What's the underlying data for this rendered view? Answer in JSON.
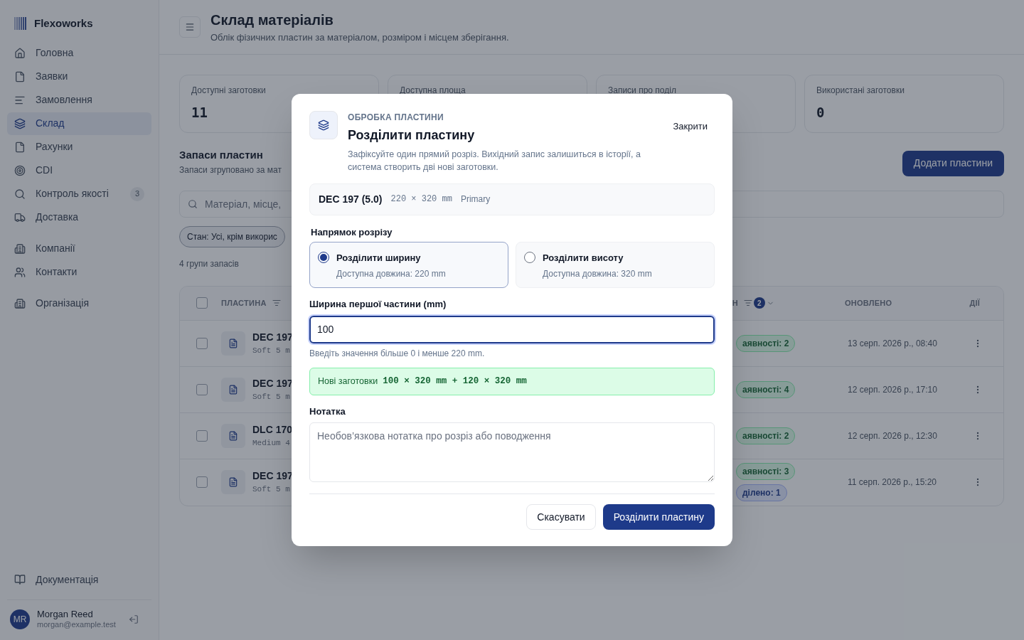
{
  "sidebar": {
    "brand": "Flexoworks",
    "groups": [
      [
        {
          "label": "Головна",
          "selected": false
        },
        {
          "label": "Заявки",
          "selected": false
        },
        {
          "label": "Замовлення",
          "selected": false
        },
        {
          "label": "Склад",
          "selected": true
        },
        {
          "label": "Рахунки",
          "selected": false
        },
        {
          "label": "CDI",
          "selected": false
        },
        {
          "label": "Контроль якості",
          "selected": false,
          "badge": "3"
        },
        {
          "label": "Доставка",
          "selected": false
        }
      ],
      [
        {
          "label": "Компанії",
          "selected": false
        },
        {
          "label": "Контакти",
          "selected": false
        }
      ],
      [
        {
          "label": "Організація",
          "selected": false
        }
      ]
    ],
    "footer_link": {
      "label": "Документація"
    },
    "user": {
      "initials": "MR",
      "name": "Morgan Reed",
      "email": "morgan@example.test"
    }
  },
  "header": {
    "title": "Склад матеріалів",
    "subtitle": "Облік фізичних пластин за матеріалом, розміром і місцем зберігання."
  },
  "stats": [
    {
      "label": "Доступні заготовки",
      "value": "11"
    },
    {
      "label": "Доступна площа"
    },
    {
      "label": "Записи про поділ"
    },
    {
      "label": "Використані заготовки",
      "value": "0"
    }
  ],
  "section": {
    "title": "Запаси пластин",
    "subtitle": "Запаси згруповано за мат",
    "add_button": "Додати пластини"
  },
  "search": {
    "placeholder": "Матеріал, місце,"
  },
  "filter_chip": "Стан: Усі, крім викорис",
  "count": "4 групи запасів",
  "table": {
    "all_selected": false,
    "columns": [
      {
        "label": "ПЛАСТИНА"
      },
      {
        "label": "Н",
        "filter_count": "2"
      },
      {
        "label": "ОНОВЛЕНО"
      },
      {
        "label": "ДІЇ"
      }
    ],
    "rows": [
      {
        "name": "DEC 197",
        "sub": "Soft 5 m",
        "badges": [
          {
            "text": "аявності: 2",
            "kind": "green"
          }
        ],
        "updated": "13 серп. 2026 р., 08:40",
        "selected": false
      },
      {
        "name": "DEC 197",
        "sub": "Soft 5 m",
        "badges": [
          {
            "text": "аявності: 4",
            "kind": "green"
          }
        ],
        "updated": "12 серп. 2026 р., 17:10",
        "selected": false
      },
      {
        "name": "DLC 170",
        "sub": "Medium 4",
        "badges": [
          {
            "text": "аявності: 2",
            "kind": "green"
          }
        ],
        "updated": "12 серп. 2026 р., 12:30",
        "selected": false
      },
      {
        "name": "DEC 197",
        "sub": "Soft 5 m",
        "badges": [
          {
            "text": "аявності: 3",
            "kind": "green"
          },
          {
            "text": "ділено: 1",
            "kind": "blue"
          }
        ],
        "updated": "11 серп. 2026 р., 15:20",
        "selected": false
      }
    ]
  },
  "dialog": {
    "eyebrow": "ОБРОБКА ПЛАСТИНИ",
    "title": "Розділити пластину",
    "close": "Закрити",
    "description": "Зафіксуйте один прямий розріз. Вихідний запис залишиться в історії, а система створить дві нові заготовки.",
    "plate": {
      "name": "DEC 197 (5.0)",
      "size": "220 × 320 mm",
      "grade": "Primary"
    },
    "direction_label": "Напрямок розрізу",
    "directions": [
      {
        "title": "Розділити ширину",
        "hint": "Доступна довжина: 220 mm",
        "selected": true
      },
      {
        "title": "Розділити висоту",
        "hint": "Доступна довжина: 320 mm",
        "selected": false
      }
    ],
    "width_label": "Ширина першої частини (mm)",
    "width_value": "100",
    "width_help": "Введіть значення більше 0 і менше 220 mm.",
    "preview_label": "Нові заготовки",
    "preview_value": "100 × 320 mm + 120 × 320 mm",
    "note_label": "Нотатка",
    "note_placeholder": "Необов’язкова нотатка про розріз або поводження",
    "cancel": "Скасувати",
    "submit": "Розділити пластину"
  }
}
